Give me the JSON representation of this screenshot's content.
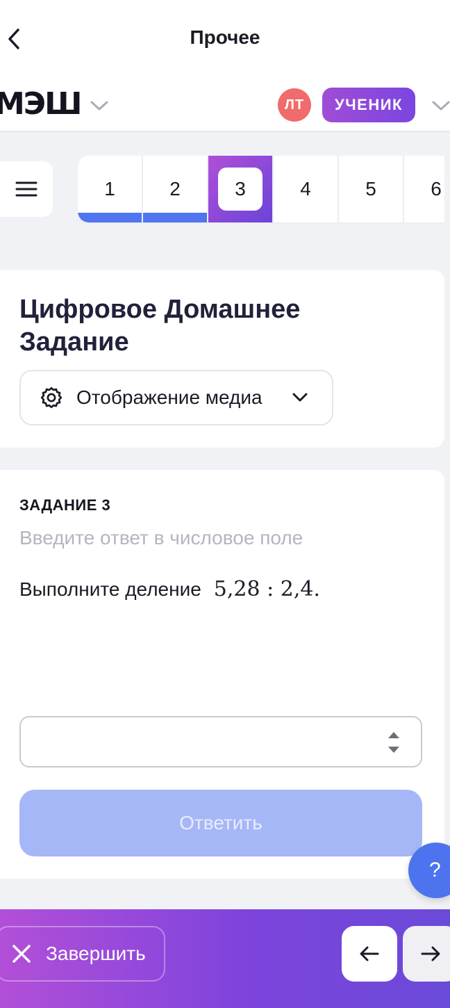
{
  "topbar": {
    "title": "Прочее"
  },
  "header": {
    "logo": "МЭШ",
    "avatar_initials": "ЛТ",
    "role": "УЧЕНИК"
  },
  "task_nav": {
    "items": [
      {
        "label": "1",
        "state": "done"
      },
      {
        "label": "2",
        "state": "done"
      },
      {
        "label": "3",
        "state": "current"
      },
      {
        "label": "4",
        "state": "pending"
      },
      {
        "label": "5",
        "state": "pending"
      },
      {
        "label": "6",
        "state": "pending"
      }
    ]
  },
  "assignment": {
    "title": "Цифровое Домашнее Задание",
    "media_label": "Отображение медиа"
  },
  "task": {
    "label": "ЗАДАНИЕ 3",
    "hint": "Введите ответ в числовое поле",
    "question": "Выполните деление",
    "expression": "5,28 : 2,4.",
    "answer_value": "",
    "submit_label": "Ответить"
  },
  "help": {
    "label": "?"
  },
  "bottom": {
    "finish_label": "Завершить"
  },
  "colors": {
    "accent_blue": "#4f75f0",
    "accent_purple": "#7a46e0",
    "avatar": "#f06b6b",
    "submit_disabled": "#a6b7f7"
  }
}
